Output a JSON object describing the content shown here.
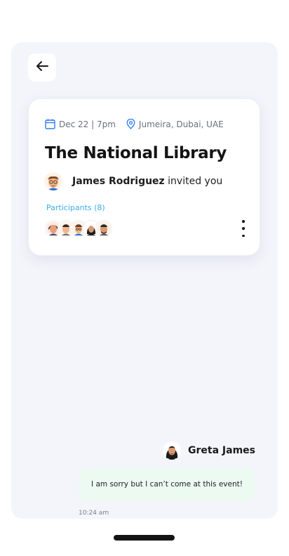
{
  "event": {
    "date_time": "Dec 22 | 7pm",
    "location": "Jumeira, Dubai, UAE",
    "title": "The National Library",
    "host_name": "James Rodriguez",
    "invite_text": " invited you",
    "participants_label": "Participants (8)"
  },
  "message": {
    "sender": "Greta James",
    "text": "I am sorry but I can’t come at this event!",
    "time": "10:24 am"
  },
  "icons": {
    "back": "arrow-left-icon",
    "calendar": "calendar-icon",
    "location": "location-pin-icon",
    "more": "more-vertical-icon"
  },
  "colors": {
    "accent_blue": "#2f7df6",
    "participants_label": "#3aaee8",
    "panel_bg": "#f4f5fb",
    "bubble_bg": "#ecfaf2"
  }
}
